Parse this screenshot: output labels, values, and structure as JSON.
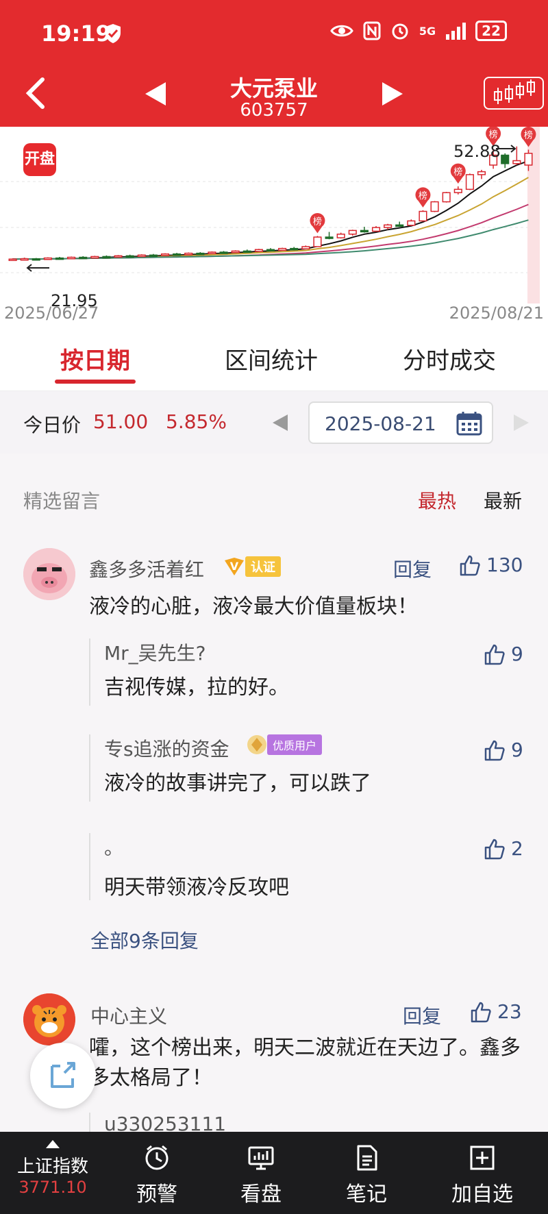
{
  "status_bar": {
    "time": "19:19",
    "network": "5G",
    "battery": "22"
  },
  "header": {
    "title": "大元泵业",
    "code": "603757"
  },
  "chart": {
    "badge": "开盘",
    "start_date": "2025/06/27",
    "end_date": "2025/08/21",
    "high_label": "52.88",
    "low_label": "21.95",
    "rank_marker": "榜"
  },
  "chart_data": {
    "type": "candlestick",
    "x_start": "2025/06/27",
    "x_end": "2025/08/21",
    "annotations": [
      {
        "label": "52.88",
        "kind": "high"
      },
      {
        "label": "21.95",
        "kind": "low"
      }
    ],
    "candles": [
      {
        "o": 21.95,
        "h": 22.4,
        "l": 21.95,
        "c": 22.2
      },
      {
        "o": 22.2,
        "h": 22.6,
        "l": 22.0,
        "c": 22.3
      },
      {
        "o": 22.3,
        "h": 22.5,
        "l": 22.0,
        "c": 22.1
      },
      {
        "o": 22.1,
        "h": 22.7,
        "l": 22.0,
        "c": 22.5
      },
      {
        "o": 22.5,
        "h": 22.8,
        "l": 22.2,
        "c": 22.3
      },
      {
        "o": 22.3,
        "h": 22.9,
        "l": 22.2,
        "c": 22.7
      },
      {
        "o": 22.7,
        "h": 23.0,
        "l": 22.4,
        "c": 22.5
      },
      {
        "o": 22.5,
        "h": 23.1,
        "l": 22.4,
        "c": 22.9
      },
      {
        "o": 22.9,
        "h": 23.2,
        "l": 22.6,
        "c": 22.8
      },
      {
        "o": 22.8,
        "h": 23.3,
        "l": 22.7,
        "c": 23.1
      },
      {
        "o": 23.1,
        "h": 23.4,
        "l": 22.8,
        "c": 22.9
      },
      {
        "o": 22.9,
        "h": 23.5,
        "l": 22.8,
        "c": 23.3
      },
      {
        "o": 23.3,
        "h": 23.6,
        "l": 23.0,
        "c": 23.2
      },
      {
        "o": 23.2,
        "h": 23.8,
        "l": 23.1,
        "c": 23.6
      },
      {
        "o": 23.6,
        "h": 23.9,
        "l": 23.3,
        "c": 23.4
      },
      {
        "o": 23.4,
        "h": 24.0,
        "l": 23.3,
        "c": 23.8
      },
      {
        "o": 23.8,
        "h": 24.1,
        "l": 23.5,
        "c": 23.7
      },
      {
        "o": 23.7,
        "h": 24.3,
        "l": 23.6,
        "c": 24.1
      },
      {
        "o": 24.1,
        "h": 24.4,
        "l": 23.8,
        "c": 24.0
      },
      {
        "o": 24.0,
        "h": 24.6,
        "l": 23.9,
        "c": 24.4
      },
      {
        "o": 24.4,
        "h": 24.8,
        "l": 24.1,
        "c": 24.3
      },
      {
        "o": 24.3,
        "h": 25.0,
        "l": 24.2,
        "c": 24.8
      },
      {
        "o": 24.8,
        "h": 25.2,
        "l": 24.5,
        "c": 24.6
      },
      {
        "o": 24.6,
        "h": 25.3,
        "l": 24.5,
        "c": 25.1
      },
      {
        "o": 25.1,
        "h": 25.5,
        "l": 24.9,
        "c": 25.0
      },
      {
        "o": 25.0,
        "h": 25.9,
        "l": 24.9,
        "c": 25.6
      },
      {
        "o": 25.6,
        "h": 28.5,
        "l": 25.5,
        "c": 28.2
      },
      {
        "o": 28.2,
        "h": 29.6,
        "l": 27.6,
        "c": 28.0
      },
      {
        "o": 28.0,
        "h": 29.4,
        "l": 27.8,
        "c": 29.0
      },
      {
        "o": 29.0,
        "h": 30.2,
        "l": 28.6,
        "c": 30.0
      },
      {
        "o": 30.0,
        "h": 31.0,
        "l": 29.4,
        "c": 29.8
      },
      {
        "o": 29.8,
        "h": 31.2,
        "l": 29.6,
        "c": 30.8
      },
      {
        "o": 30.8,
        "h": 31.8,
        "l": 30.2,
        "c": 31.5
      },
      {
        "o": 31.5,
        "h": 32.4,
        "l": 31.0,
        "c": 31.4
      },
      {
        "o": 31.4,
        "h": 33.0,
        "l": 31.2,
        "c": 32.6
      },
      {
        "o": 32.6,
        "h": 35.5,
        "l": 32.4,
        "c": 35.2
      },
      {
        "o": 35.2,
        "h": 38.0,
        "l": 35.0,
        "c": 37.8
      },
      {
        "o": 37.8,
        "h": 40.5,
        "l": 37.6,
        "c": 40.3
      },
      {
        "o": 40.3,
        "h": 42.0,
        "l": 39.8,
        "c": 41.2
      },
      {
        "o": 41.2,
        "h": 45.5,
        "l": 41.0,
        "c": 45.2
      },
      {
        "o": 45.2,
        "h": 46.5,
        "l": 44.0,
        "c": 46.0
      },
      {
        "o": 47.8,
        "h": 52.2,
        "l": 46.8,
        "c": 50.5
      },
      {
        "o": 50.5,
        "h": 51.0,
        "l": 47.0,
        "c": 48.2
      },
      {
        "o": 48.2,
        "h": 52.88,
        "l": 47.8,
        "c": 49.0
      },
      {
        "o": 47.8,
        "h": 52.0,
        "l": 46.2,
        "c": 51.0
      }
    ],
    "ma_series": [
      {
        "color": "#111111",
        "values_end": 50.5
      },
      {
        "color": "#c9a431",
        "values_end": 45.0
      },
      {
        "color": "#c23a6e",
        "values_end": 37.5
      },
      {
        "color": "#3f8a6e",
        "values_end": 33.0
      }
    ],
    "ylim": [
      20,
      56
    ]
  },
  "tabs": [
    {
      "label": "按日期",
      "active": true
    },
    {
      "label": "区间统计",
      "active": false
    },
    {
      "label": "分时成交",
      "active": false
    }
  ],
  "price_bar": {
    "label": "今日价",
    "price": "51.00",
    "change_pct": "5.85%",
    "date": "2025-08-21"
  },
  "comments_section": {
    "title": "精选留言",
    "sort_hot": "最热",
    "sort_new": "最新"
  },
  "comments": [
    {
      "user": "鑫多多活着红",
      "badge": "认证",
      "text": "液冷的心脏，液冷最大价值量板块！",
      "reply_label": "回复",
      "likes": "130",
      "replies": [
        {
          "user": "Mr_吴先生?",
          "text": "吉视传媒，拉的好。",
          "likes": "9"
        },
        {
          "user": "专s追涨的资金",
          "badge": "优质用户",
          "text": "液冷的故事讲完了，可以跌了",
          "likes": "9"
        },
        {
          "user": "。",
          "text": "明天带领液冷反攻吧",
          "likes": "2"
        }
      ],
      "all_replies": "全部9条回复"
    },
    {
      "user": "中心主义",
      "text": "嚯，这个榜出来，明天二波就近在天边了。鑫多多太格局了！",
      "reply_label": "回复",
      "likes": "23",
      "replies": [
        {
          "user": "u330253111",
          "text": "",
          "likes": ""
        }
      ]
    }
  ],
  "bottom_bar": {
    "index_name": "上证指数",
    "index_value": "3771.10",
    "items": [
      "预警",
      "看盘",
      "笔记",
      "加自选"
    ]
  },
  "colors": {
    "brand_red": "#e32b2e",
    "up_red": "#d8262e",
    "down_green": "#1f6d2a",
    "link_blue": "#3a5180"
  }
}
